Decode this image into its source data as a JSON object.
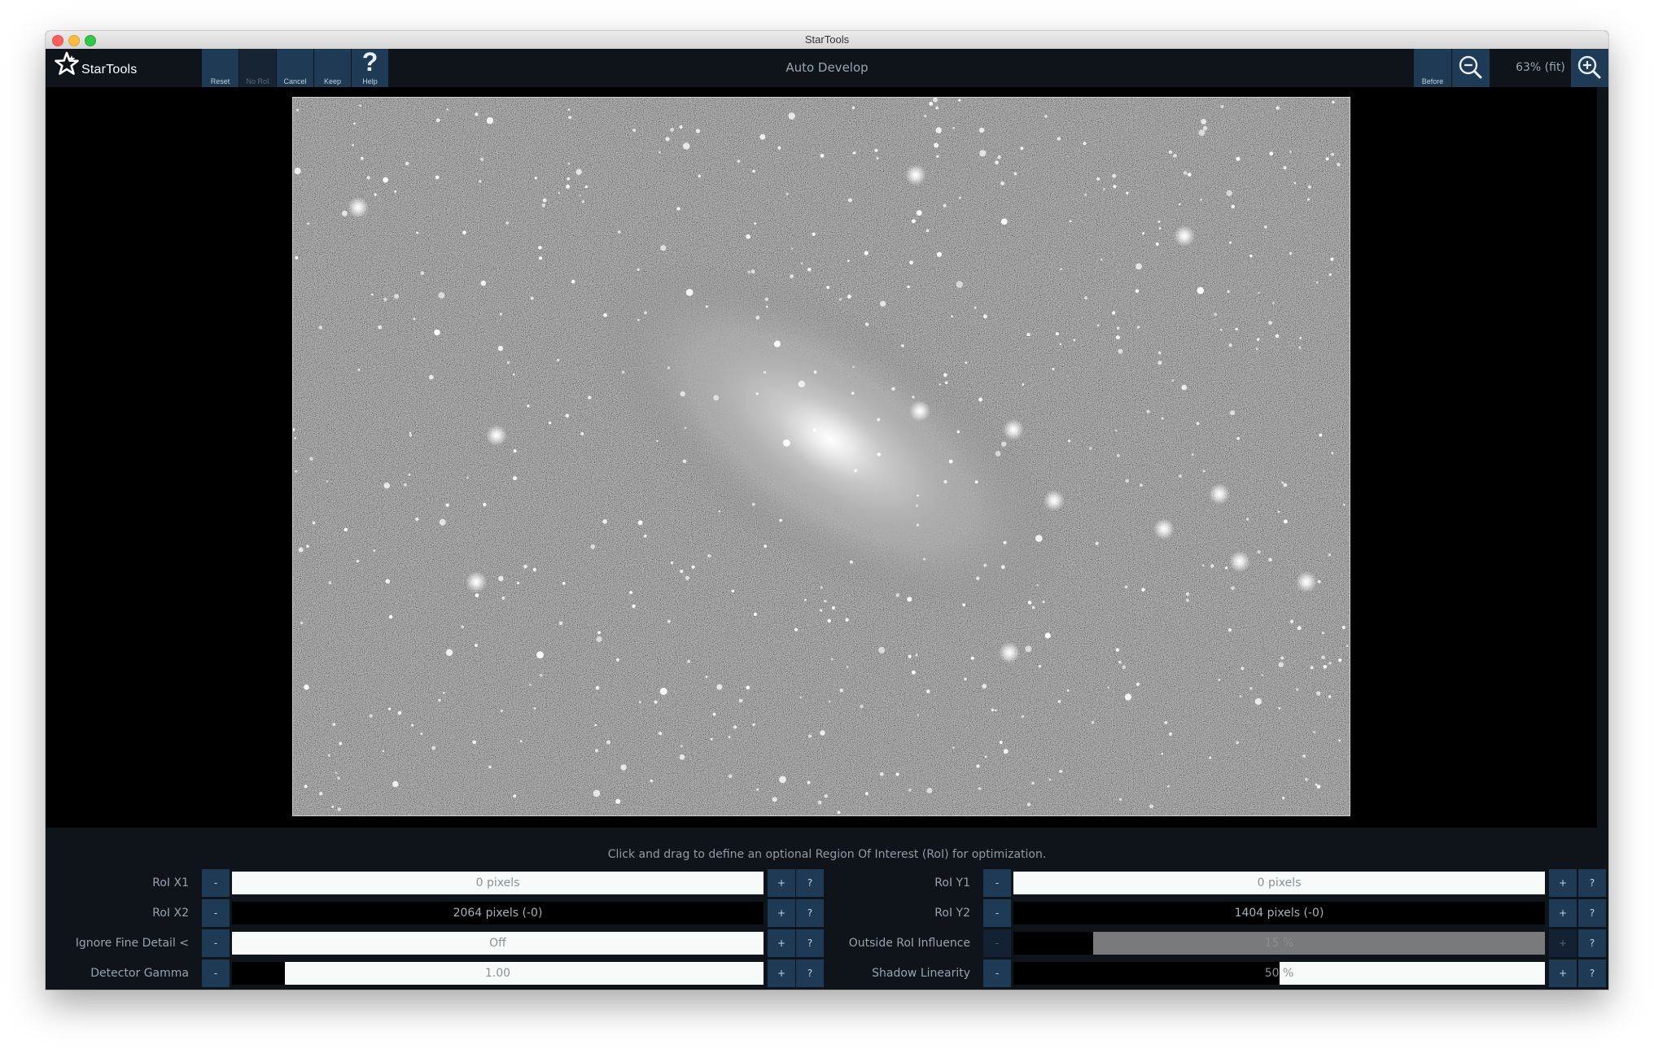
{
  "window": {
    "title": "StarTools"
  },
  "app": {
    "logo_text": "StarTools"
  },
  "toolbar": {
    "left_buttons": [
      {
        "label": "Reset",
        "enabled": true
      },
      {
        "label": "No RoI",
        "enabled": false
      },
      {
        "label": "Cancel",
        "enabled": true
      },
      {
        "label": "Keep",
        "enabled": true
      },
      {
        "label": "Help",
        "enabled": true,
        "icon": "question-mark-icon"
      }
    ],
    "mode_title": "Auto Develop",
    "before_label": "Before",
    "zoom_out_icon": "zoom-out-icon",
    "zoom_level": "63% (fit)",
    "zoom_in_icon": "zoom-in-icon"
  },
  "hint": "Click and drag to define an optional Region Of Interest (RoI) for optimization.",
  "params": {
    "minus_label": "-",
    "plus_label": "+",
    "help_label": "?",
    "left": [
      {
        "label": "RoI X1",
        "value": "0 pixels",
        "fill": 0.0,
        "enabled": true
      },
      {
        "label": "RoI X2",
        "value": "2064 pixels (-0)",
        "fill": 1.0,
        "enabled": true
      },
      {
        "label": "Ignore Fine Detail <",
        "value": "Off",
        "fill": 0.0,
        "enabled": true
      },
      {
        "label": "Detector Gamma",
        "value": "1.00",
        "fill": 0.1,
        "enabled": true
      }
    ],
    "right": [
      {
        "label": "RoI Y1",
        "value": "0 pixels",
        "fill": 0.0,
        "enabled": true
      },
      {
        "label": "RoI Y2",
        "value": "1404 pixels (-0)",
        "fill": 1.0,
        "enabled": true
      },
      {
        "label": "Outside RoI Influence",
        "value": "15 %",
        "fill": 0.15,
        "enabled": false
      },
      {
        "label": "Shadow Linearity",
        "value": "50 %",
        "fill": 0.5,
        "enabled": true
      }
    ]
  },
  "colors": {
    "toolbar_bg": "#0f141b",
    "button_bg": "#1e3a55",
    "slider_bg": "#f6fbfa",
    "slider_fill": "#000000"
  }
}
